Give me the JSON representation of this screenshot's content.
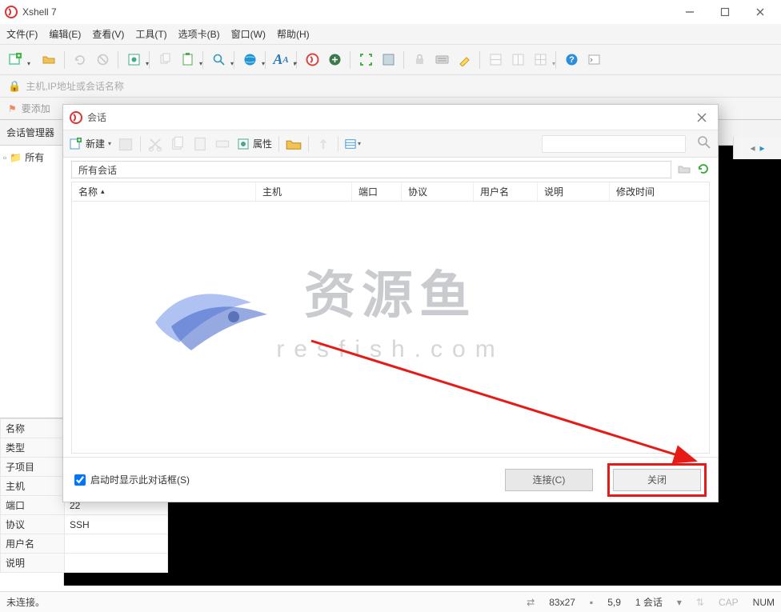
{
  "app": {
    "title": "Xshell 7"
  },
  "menu": {
    "file": "文件(F)",
    "edit": "编辑(E)",
    "view": "查看(V)",
    "tools": "工具(T)",
    "tabs": "选项卡(B)",
    "window": "窗口(W)",
    "help": "帮助(H)"
  },
  "addrbar": {
    "placeholder": "主机,IP地址或会话名称"
  },
  "bookbar": {
    "text": "要添加"
  },
  "session_manager": {
    "title": "会话管理器",
    "tree_root": "所有"
  },
  "dialog": {
    "title": "会话",
    "new_label": "新建",
    "prop_label": "属性",
    "path_value": "所有会话",
    "columns": {
      "name": "名称",
      "host": "主机",
      "port": "端口",
      "protocol": "协议",
      "user": "用户名",
      "desc": "说明",
      "mtime": "修改时间"
    },
    "checkbox_label": "启动时显示此对话框(S)",
    "connect_label": "连接(C)",
    "close_label": "关闭"
  },
  "watermark": {
    "big": "资源鱼",
    "sub": "resfish.com"
  },
  "props": {
    "name_k": "名称",
    "name_v": "",
    "type_k": "类型",
    "type_v": "",
    "sub_k": "子项目",
    "sub_v": "",
    "host_k": "主机",
    "host_v": "",
    "port_k": "端口",
    "port_v": "22",
    "proto_k": "协议",
    "proto_v": "SSH",
    "user_k": "用户名",
    "user_v": "",
    "desc_k": "说明",
    "desc_v": ""
  },
  "status": {
    "left": "未连接。",
    "dim": "83x27",
    "pos": "5,9",
    "sessions": "1 会话",
    "cap": "CAP",
    "num": "NUM"
  }
}
